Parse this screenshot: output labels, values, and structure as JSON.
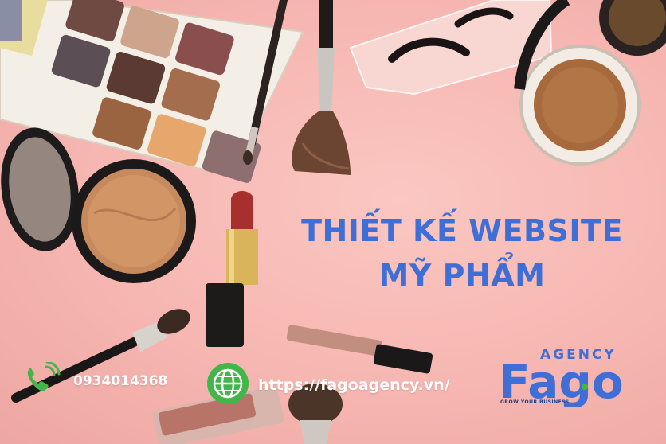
{
  "headline": {
    "line1": "THIẾT KẾ WEBSITE",
    "line2": "MỸ PHẨM"
  },
  "contact": {
    "phone": "0934014368",
    "website": "https://fagoagency.vn/"
  },
  "logo": {
    "wordmark": "Fago",
    "tagline": "AGENCY",
    "subtitle": "GROW YOUR BUSINESS"
  },
  "colors": {
    "background": "#f6b8b4",
    "headline": "#3f6fd6",
    "accent_green": "#43b649",
    "logo_blue": "#3f6fd6"
  },
  "icons": [
    "phone-icon",
    "globe-icon"
  ]
}
